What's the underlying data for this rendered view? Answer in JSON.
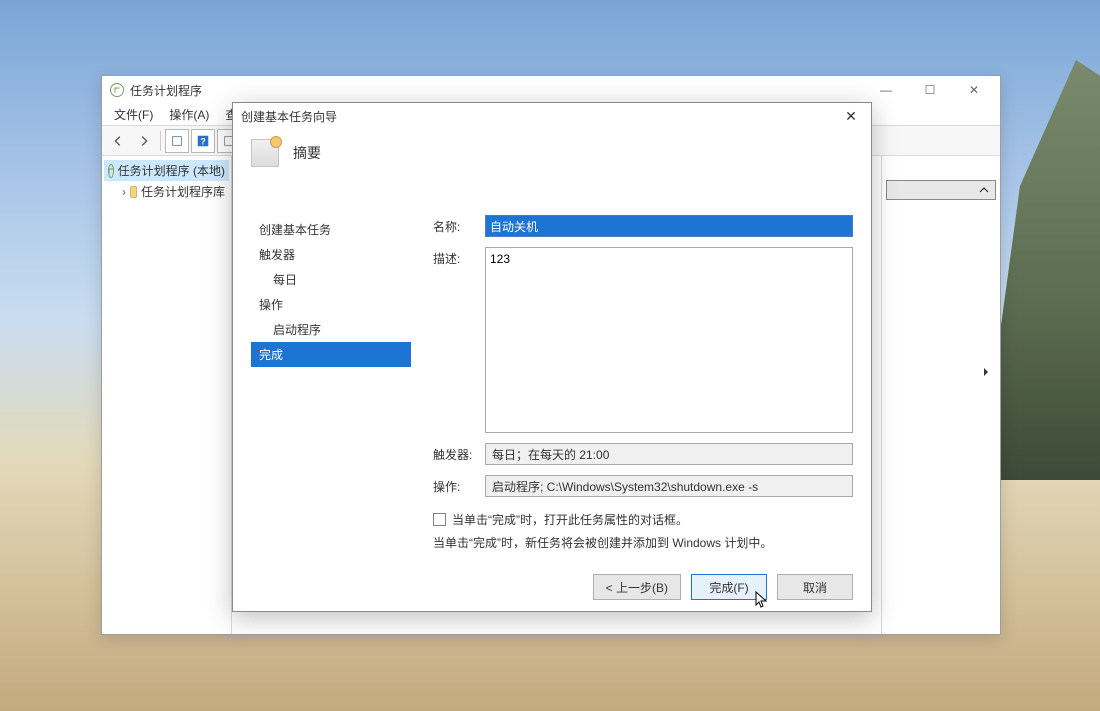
{
  "main_window": {
    "title": "任务计划程序",
    "menubar": {
      "file": "文件(F)",
      "action": "操作(A)",
      "view_partial": "查"
    },
    "tree": {
      "root": "任务计划程序 (本地)",
      "library": "任务计划程序库"
    },
    "winctrl": {
      "min": "—",
      "max": "☐",
      "close": "✕"
    }
  },
  "wizard": {
    "title": "创建基本任务向导",
    "header": "摘要",
    "steps": {
      "create": "创建基本任务",
      "trigger": "触发器",
      "daily": "每日",
      "action": "操作",
      "start_program": "启动程序",
      "finish": "完成"
    },
    "form": {
      "name_label": "名称:",
      "name_value": "自动关机",
      "desc_label": "描述:",
      "desc_value": "123",
      "trigger_label": "触发器:",
      "trigger_value": "每日；在每天的 21:00",
      "action_label": "操作:",
      "action_value": "启动程序; C:\\Windows\\System32\\shutdown.exe -s",
      "checkbox_label": "当单击“完成”时，打开此任务属性的对话框。",
      "hint": "当单击“完成”时，新任务将会被创建并添加到 Windows 计划中。"
    },
    "buttons": {
      "back": "< 上一步(B)",
      "finish": "完成(F)",
      "cancel": "取消"
    }
  }
}
